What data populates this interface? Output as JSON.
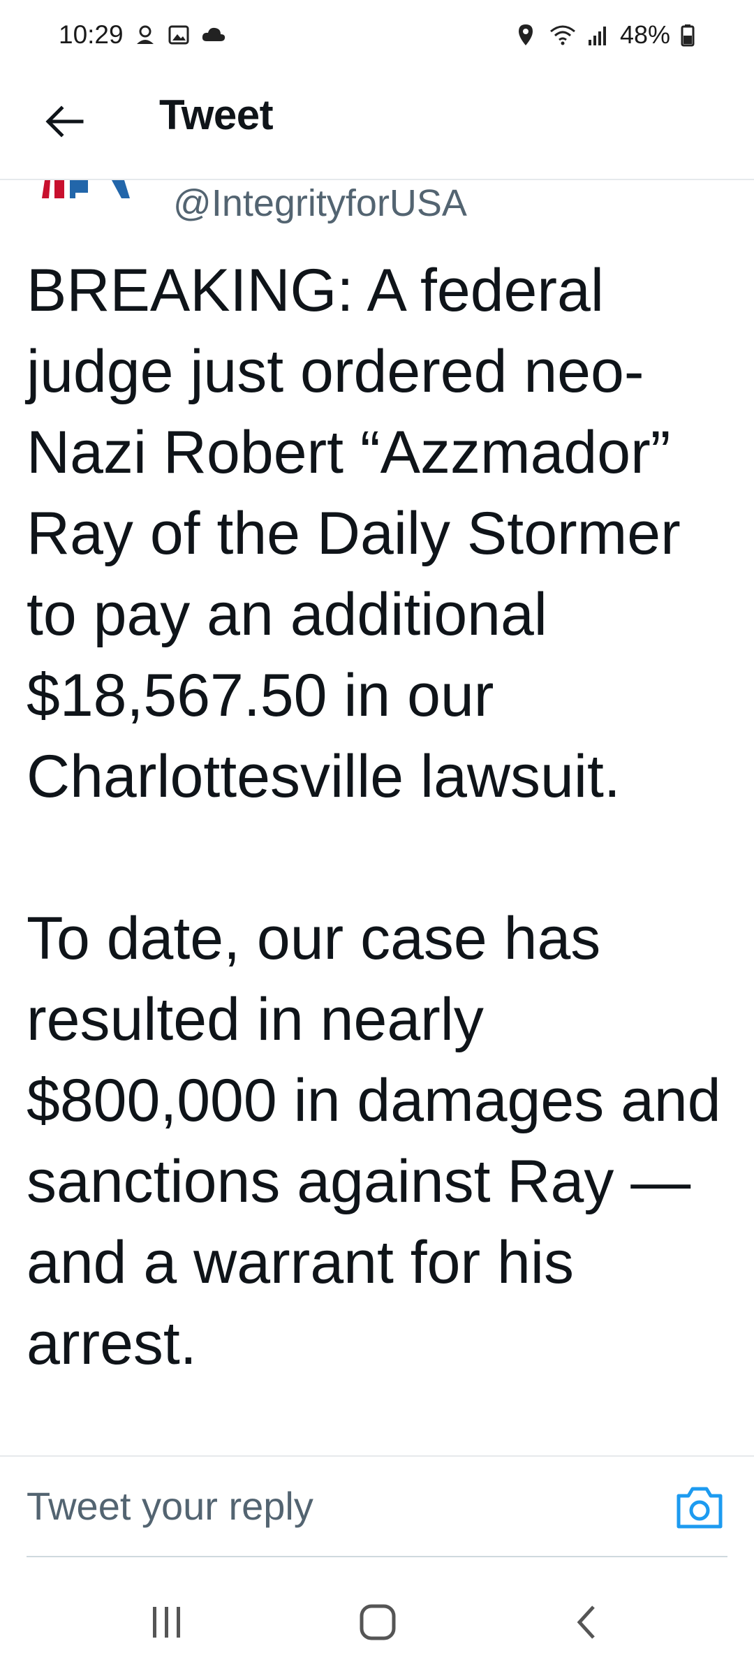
{
  "status_bar": {
    "time": "10:29",
    "battery": "48%",
    "icons_left": [
      "account-icon",
      "image-icon",
      "cloud-icon"
    ],
    "icons_right": [
      "location-icon",
      "wifi-icon",
      "signal-icon",
      "battery-icon"
    ]
  },
  "header": {
    "title": "Tweet"
  },
  "tweet": {
    "handle": "@IntegrityforUSA",
    "text": "BREAKING: A federal judge just ordered neo-Nazi Robert “Azzmador” Ray of the Daily Stormer to pay an additional $18,567.50 in our Charlottesville lawsuit.\n\nTo date, our case has resulted in nearly $800,000 in damages and sanctions against Ray — and a warrant for his arrest."
  },
  "reply": {
    "placeholder": "Tweet your reply"
  },
  "colors": {
    "accent": "#1d9bf0",
    "text": "#0f1419",
    "secondary": "#536471",
    "divider": "#e6e9ec"
  }
}
